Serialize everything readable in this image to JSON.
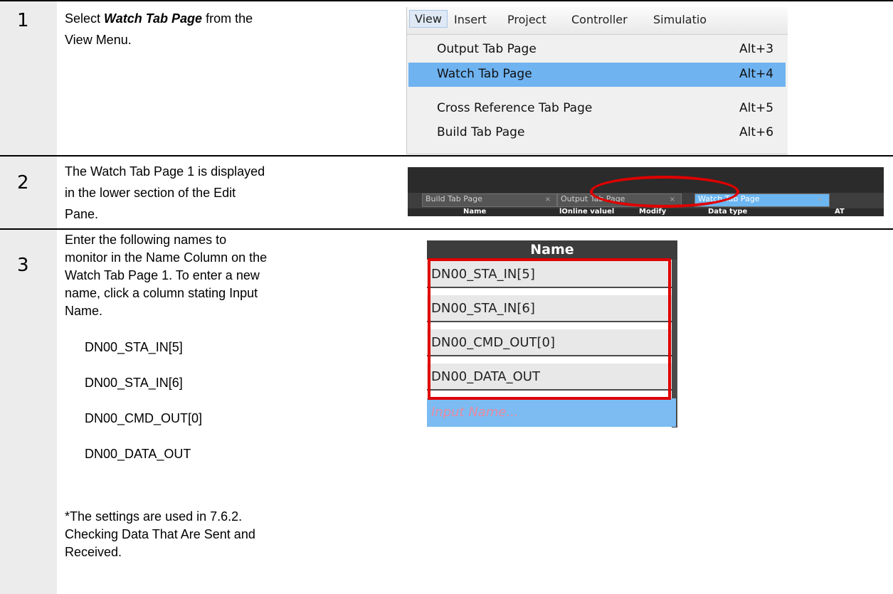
{
  "steps": [
    {
      "number": "1",
      "text_pre": "Select ",
      "text_bold": "Watch Tab Page",
      "text_post": " from the\nView Menu."
    },
    {
      "number": "2",
      "text": "The Watch Tab Page 1 is displayed\nin the lower section of the Edit\nPane."
    },
    {
      "number": "3",
      "text": "Enter the following names to\nmonitor in the Name Column on the\nWatch Tab Page 1. To enter a new\nname, click a column stating Input\nName.",
      "names": [
        "DN00_STA_IN[5]",
        "DN00_STA_IN[6]",
        "DN00_CMD_OUT[0]",
        "DN00_DATA_OUT"
      ],
      "note": "*The settings are used in 7.6.2.\n Checking Data That Are Sent and\n Received."
    }
  ],
  "menu": {
    "bar": [
      "View",
      "Insert",
      "Project",
      "Controller",
      "Simulatio"
    ],
    "items": [
      {
        "label": "Output Tab Page",
        "shortcut": "Alt+3"
      },
      {
        "label": "Watch Tab Page",
        "shortcut": "Alt+4"
      },
      {
        "label": "Cross Reference Tab Page",
        "shortcut": "Alt+5"
      },
      {
        "label": "Build Tab Page",
        "shortcut": "Alt+6"
      }
    ],
    "highlight_color": "#6fb3f0"
  },
  "tabstrip": {
    "tabs": [
      "Build Tab Page",
      "Output Tab Page",
      "Watch Tab Page"
    ],
    "close_glyph": "×",
    "columns": [
      "Name",
      "lOnline valuel",
      "Modify",
      "Data type",
      "AT"
    ]
  },
  "namecol": {
    "header": "Name",
    "rows": [
      "DN00_STA_IN[5]",
      "DN00_STA_IN[6]",
      "DN00_CMD_OUT[0]",
      "DN00_DATA_OUT"
    ],
    "input_placeholder": "Input Name..."
  },
  "colors": {
    "highlight_red": "#e00000",
    "step_column": "#ececec",
    "active_tab": "#6cb6f2"
  }
}
